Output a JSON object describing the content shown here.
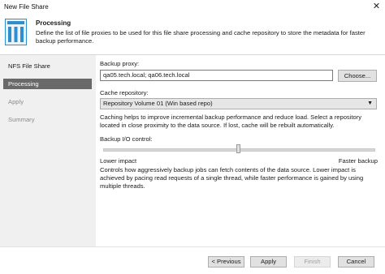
{
  "window": {
    "title": "New File Share",
    "close_glyph": "✕"
  },
  "header": {
    "title": "Processing",
    "description": "Define the list of file proxies to be used for this file share processing and cache repository to store the metadata for faster backup performance."
  },
  "sidebar": {
    "items": [
      {
        "label": "NFS File Share",
        "state": "enabled"
      },
      {
        "label": "Processing",
        "state": "selected"
      },
      {
        "label": "Apply",
        "state": "disabled"
      },
      {
        "label": "Summary",
        "state": "disabled"
      }
    ]
  },
  "main": {
    "backup_proxy": {
      "label": "Backup proxy:",
      "value": "qa05.tech.local; qa06.tech.local",
      "button": "Choose..."
    },
    "cache_repository": {
      "label": "Cache repository:",
      "value": "Repository Volume 01 (Win based repo)",
      "help": "Caching helps to improve incremental backup performance and reduce load. Select a repository located in close proximity to the data source. If lost, cache will be rebuilt automatically."
    },
    "backup_io": {
      "label": "Backup I/O control:",
      "level": 0.5,
      "low_label": "Lower impact",
      "high_label": "Faster backup",
      "help": "Controls how aggressively backup jobs can fetch contents of the data source. Lower impact is achieved by pacing read requests of a single thread, while faster performance is gained by using multiple threads."
    }
  },
  "footer": {
    "previous": "< Previous",
    "apply": "Apply",
    "finish": "Finish",
    "cancel": "Cancel"
  },
  "colors": {
    "selected_nav": "#696969",
    "sidebar_bg": "#f0f0f0",
    "icon_blue": "#2f8fce"
  },
  "icons": {
    "header": "file-share-icon",
    "select_arrow": "chevron-down-icon"
  }
}
